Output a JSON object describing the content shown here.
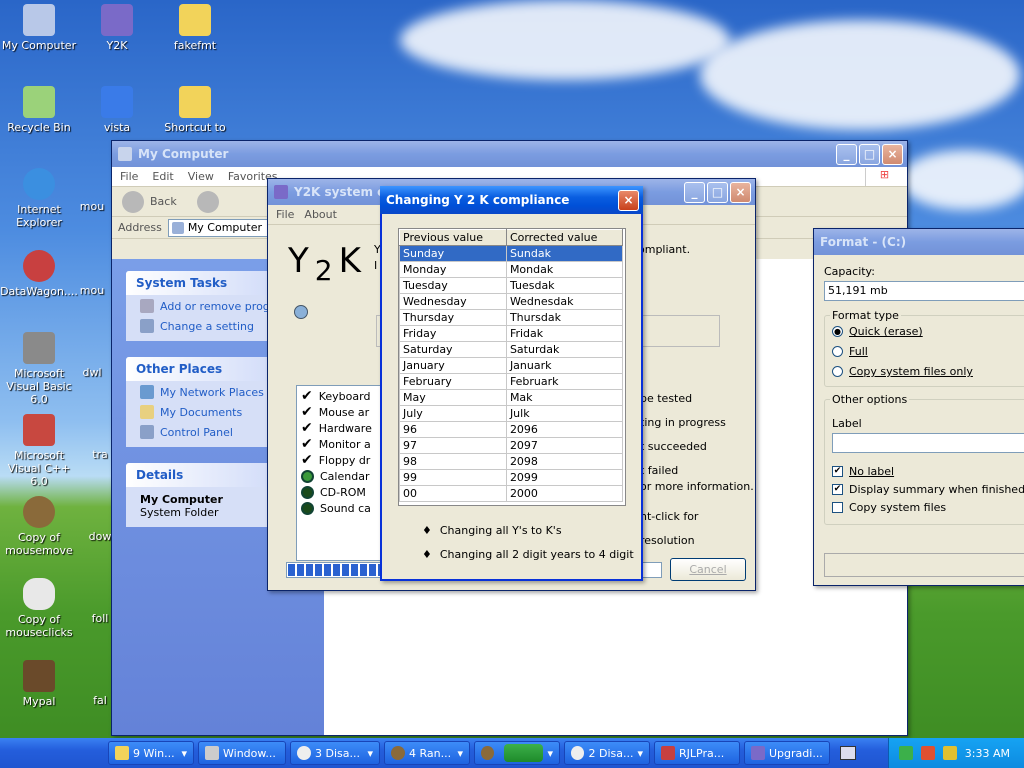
{
  "desktop_icons": [
    {
      "label": "My Computer",
      "color": "#b8c8e8"
    },
    {
      "label": "Y2K",
      "color": "#7a6ac8"
    },
    {
      "label": "fakefmt",
      "color": "#f2d35a"
    },
    {
      "label": "Recycle Bin",
      "color": "#9bd27a"
    },
    {
      "label": "vista",
      "color": "#3a7be8"
    },
    {
      "label": "Shortcut to",
      "color": "#f2d35a"
    },
    {
      "label": "Internet Explorer",
      "color": "#3b8fe0"
    },
    {
      "label": "DataWagon....",
      "color": "#c84040"
    },
    {
      "label": "Microsoft Visual Basic 6.0",
      "color": "#8a8a8a"
    },
    {
      "label": "Microsoft Visual C++ 6.0",
      "color": "#c84840"
    },
    {
      "label": "Copy of mousemove",
      "color": "#8a6a3a"
    },
    {
      "label": "Copy of mouseclicks",
      "color": "#e8e8e8"
    },
    {
      "label": "Mypal",
      "color": "#6a4a2a"
    }
  ],
  "partial_icons": [
    "mou",
    "mou",
    "dwl",
    "tra",
    "dow",
    "foll",
    "fal"
  ],
  "mycomputer": {
    "title": "My Computer",
    "menu": [
      "File",
      "Edit",
      "View",
      "Favorites"
    ],
    "back": "Back",
    "address_label": "Address",
    "address_value": "My Computer",
    "system_tasks": {
      "title": "System Tasks",
      "items": [
        "Add or remove programs",
        "Change a setting"
      ]
    },
    "other_places": {
      "title": "Other Places",
      "items": [
        "My Network Places",
        "My Documents",
        "Control Panel"
      ]
    },
    "details": {
      "title": "Details",
      "name": "My Computer",
      "sub": "System Folder"
    }
  },
  "y2k": {
    "title": "Y2K system ch",
    "menu": [
      "File",
      "About"
    ],
    "logo": {
      "y": "Y",
      "two": "2",
      "k": "K"
    },
    "intro_a": "Y",
    "intro_b": "I",
    "compliant": "ompliant.",
    "checks": [
      "Keyboard",
      "Mouse ar",
      "Hardware",
      "Monitor a",
      "Floppy dr",
      "Calendar",
      "CD-ROM",
      "Sound ca"
    ],
    "legend": [
      "be tested",
      "ting in progress",
      "t succeeded",
      "t failed",
      "or more information.",
      "ht-click for resolution"
    ],
    "progress": 0.62
  },
  "dialog": {
    "title": "Changing Y 2 K compliance",
    "col_prev": "Previous value",
    "col_corr": "Corrected value",
    "rows": [
      [
        "Sunday",
        "Sundak"
      ],
      [
        "Monday",
        "Mondak"
      ],
      [
        "Tuesday",
        "Tuesdak"
      ],
      [
        "Wednesday",
        "Wednesdak"
      ],
      [
        "Thursday",
        "Thursdak"
      ],
      [
        "Friday",
        "Fridak"
      ],
      [
        "Saturday",
        "Saturdak"
      ],
      [
        "January",
        "Januark"
      ],
      [
        "February",
        "Februark"
      ],
      [
        "May",
        "Mak"
      ],
      [
        "July",
        "Julk"
      ],
      [
        "96",
        "2096"
      ],
      [
        "97",
        "2097"
      ],
      [
        "98",
        "2098"
      ],
      [
        "99",
        "2099"
      ],
      [
        "00",
        "2000"
      ]
    ],
    "bullet1": "Changing all Y's to K's",
    "bullet2": "Changing all 2 digit years to 4 digit",
    "cancel": "Cancel"
  },
  "format": {
    "title": "Format -  (C:)",
    "capacity_label": "Capacity:",
    "capacity_value": "51,191 mb",
    "format_type": "Format type",
    "opt_quick": "Quick (erase)",
    "opt_full": "Full",
    "opt_copy": "Copy system files only",
    "other_options": "Other options",
    "label": "Label",
    "no_label": "No label",
    "display_summary": "Display summary when finished",
    "copy_system": "Copy system files"
  },
  "taskbar": {
    "tasks": [
      "9 Win...",
      "Window...",
      "3 Disa...",
      "4 Ran...",
      "",
      "2 Disa...",
      "RJLPra...",
      "Upgradi..."
    ],
    "clock": "3:33 AM"
  }
}
